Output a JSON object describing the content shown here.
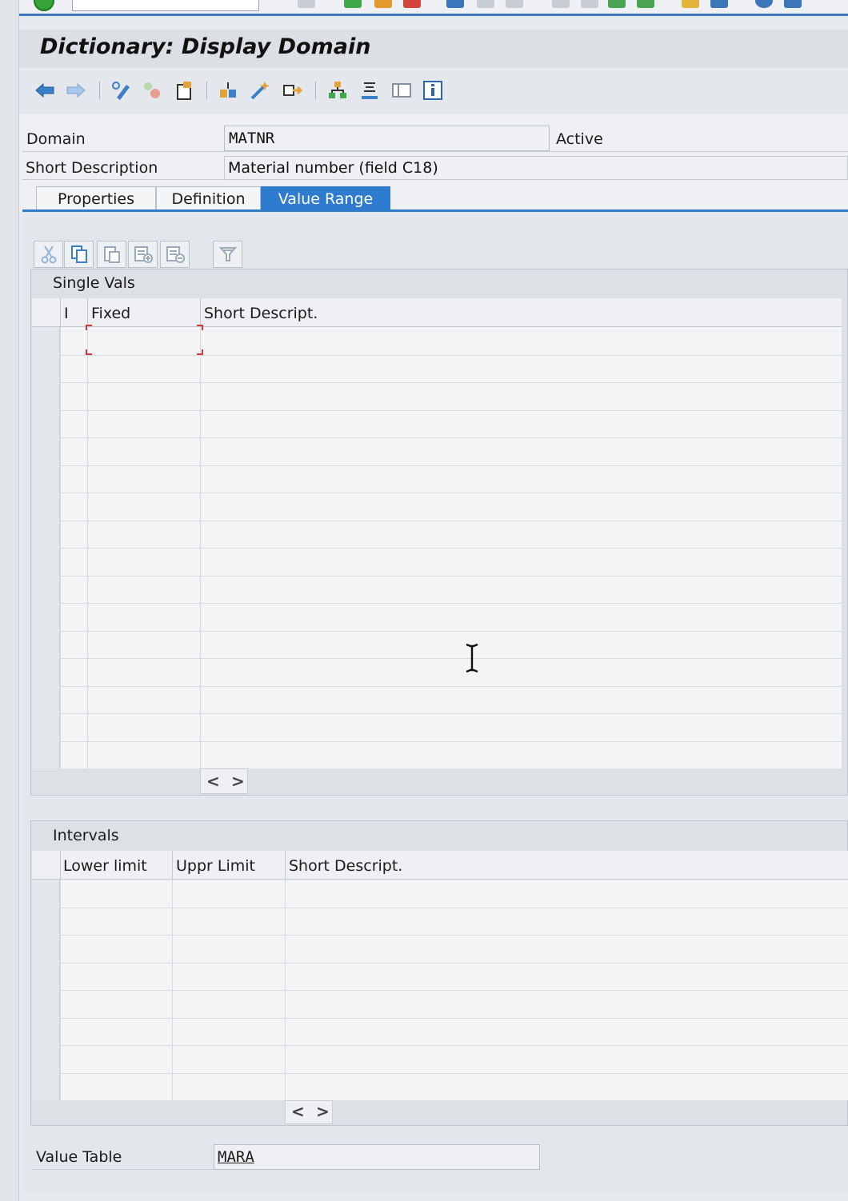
{
  "window": {
    "title": "Dictionary: Display Domain"
  },
  "header": {
    "domain_label": "Domain",
    "domain_value": "MATNR",
    "domain_status": "Active",
    "short_desc_label": "Short Description",
    "short_desc_value": "Material number (field C18)"
  },
  "tabs": [
    {
      "label": "Properties"
    },
    {
      "label": "Definition"
    },
    {
      "label": "Value Range"
    }
  ],
  "single_values": {
    "caption": "Single Vals",
    "columns": [
      "I",
      "Fixed",
      "Short Descript."
    ]
  },
  "intervals": {
    "caption": "Intervals",
    "columns": [
      "Lower limit",
      "Uppr Limit",
      "Short Descript."
    ]
  },
  "value_table": {
    "label": "Value Table",
    "value": "MARA"
  },
  "scroll": {
    "left": "<",
    "right": ">"
  },
  "colors": {
    "accent": "#2f7bcf",
    "background": "#e3e6ea",
    "grid": "#f3f4f6"
  }
}
